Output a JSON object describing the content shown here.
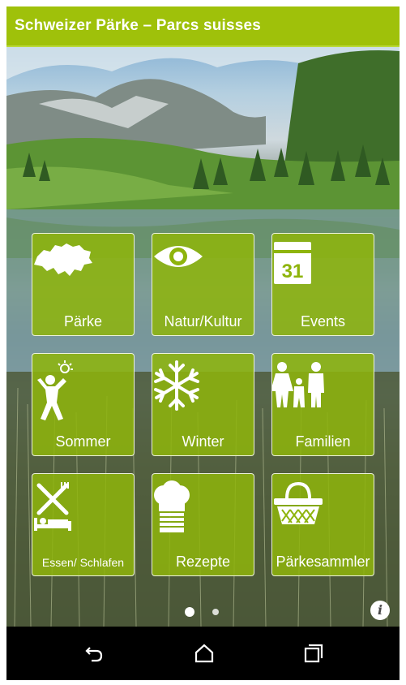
{
  "app": {
    "title": "Schweizer Pärke – Parcs suisses"
  },
  "tiles": [
    {
      "label": "Pärke",
      "icon": "switzerland-map-icon"
    },
    {
      "label": "Natur/Kultur",
      "icon": "eye-icon"
    },
    {
      "label": "Events",
      "icon": "calendar-icon",
      "calendar_day": "31"
    },
    {
      "label": "Sommer",
      "icon": "summer-person-sun-icon"
    },
    {
      "label": "Winter",
      "icon": "snowflake-icon"
    },
    {
      "label": "Familien",
      "icon": "family-icon"
    },
    {
      "label": "Essen/ Schlafen",
      "icon": "fork-knife-bed-icon"
    },
    {
      "label": "Rezepte",
      "icon": "chef-hat-icon"
    },
    {
      "label": "Pärkesammler",
      "icon": "basket-icon"
    }
  ],
  "pager": {
    "pages": 2,
    "active_page": 1
  },
  "info": {
    "glyph": "i",
    "icon": "info-icon"
  },
  "navigation": {
    "buttons": [
      "back-icon",
      "home-icon",
      "recent-apps-icon"
    ]
  },
  "colors": {
    "app_bar": "#9fc10a",
    "tile": "#8eb40c",
    "nav_bar": "#000000"
  }
}
